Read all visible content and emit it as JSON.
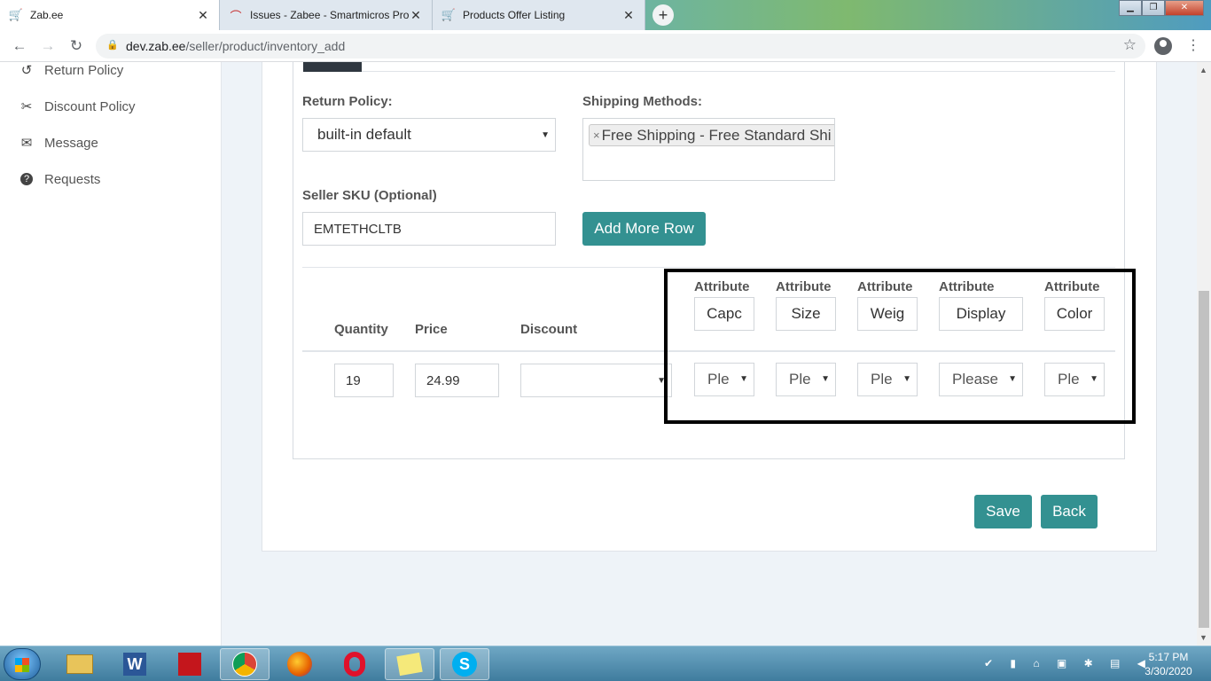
{
  "browser": {
    "tabs": [
      {
        "title": "Zab.ee",
        "icon": "cart-icon"
      },
      {
        "title": "Issues - Zabee - Smartmicros Pro",
        "icon": "issue-tracker-icon"
      },
      {
        "title": "Products Offer Listing",
        "icon": "cart-icon"
      }
    ],
    "new_tab": "+",
    "url_host": "dev.zab.ee",
    "url_path": "/seller/product/inventory_add"
  },
  "sidebar": {
    "items": [
      {
        "label": "Return Policy",
        "icon": "undo-icon"
      },
      {
        "label": "Discount Policy",
        "icon": "scissors-icon"
      },
      {
        "label": "Message",
        "icon": "envelope-icon"
      },
      {
        "label": "Requests",
        "icon": "question-circle-icon"
      }
    ]
  },
  "form": {
    "return_policy_label": "Return Policy:",
    "return_policy_value": "built-in default",
    "shipping_label": "Shipping Methods:",
    "shipping_chip": "Free Shipping - Free Standard Shi",
    "sku_label": "Seller SKU (Optional)",
    "sku_value": "EMTETHCLTB",
    "add_row_label": "Add More Row"
  },
  "table": {
    "headers": {
      "quantity": "Quantity",
      "price": "Price",
      "discount": "Discount"
    },
    "attribute_label": "Attribute",
    "attributes": [
      "Capc",
      "Size",
      "Weig",
      "Display",
      "Color"
    ],
    "row": {
      "quantity": "19",
      "price": "24.99",
      "discount": "",
      "attr_selects": [
        "Ple",
        "Ple",
        "Ple",
        "Please",
        "Ple"
      ]
    }
  },
  "actions": {
    "save": "Save",
    "back": "Back"
  },
  "taskbar": {
    "time": "5:17 PM",
    "date": "3/30/2020"
  },
  "colors": {
    "accent": "#339191",
    "highlight_border": "#000000"
  }
}
